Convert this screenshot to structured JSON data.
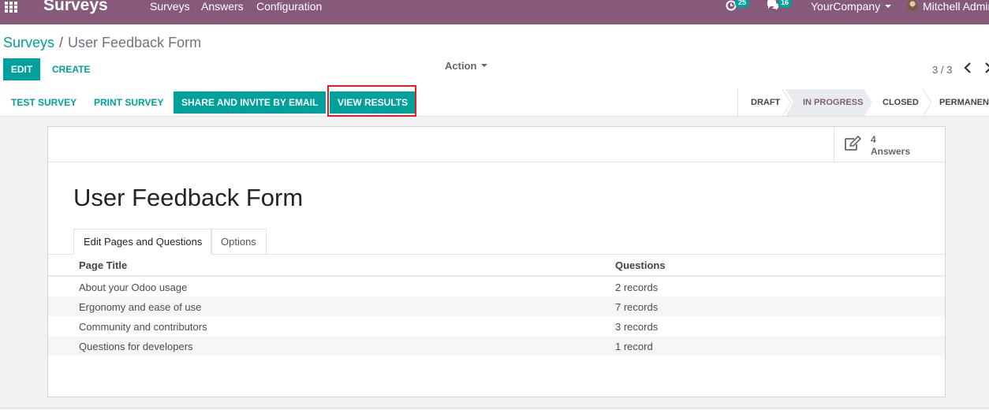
{
  "navbar": {
    "app_name": "Surveys",
    "menu": [
      "Surveys",
      "Answers",
      "Configuration"
    ],
    "activity_count": "25",
    "message_count": "16",
    "company": "YourCompany",
    "user": "Mitchell Admin"
  },
  "breadcrumb": {
    "parent": "Surveys",
    "current": "User Feedback Form"
  },
  "buttons": {
    "edit": "EDIT",
    "create": "CREATE",
    "action": "Action"
  },
  "pager": {
    "value": "3 / 3"
  },
  "statusbar": {
    "buttons": [
      "TEST SURVEY",
      "PRINT SURVEY",
      "SHARE AND INVITE BY EMAIL",
      "VIEW RESULTS"
    ],
    "stages": [
      "DRAFT",
      "IN PROGRESS",
      "CLOSED",
      "PERMANENT"
    ],
    "current_stage": "IN PROGRESS"
  },
  "stat_button": {
    "value": "4",
    "label": "Answers"
  },
  "form": {
    "title": "User Feedback Form",
    "tabs": [
      "Edit Pages and Questions",
      "Options"
    ]
  },
  "list": {
    "columns": [
      "Page Title",
      "Questions"
    ],
    "rows": [
      {
        "title": "About your Odoo usage",
        "questions": "2 records"
      },
      {
        "title": "Ergonomy and ease of use",
        "questions": "7 records"
      },
      {
        "title": "Community and contributors",
        "questions": "3 records"
      },
      {
        "title": "Questions for developers",
        "questions": "1 record"
      }
    ]
  },
  "colors": {
    "navbar": "#875a7b",
    "accent": "#00a09d",
    "highlight": "#e31c22"
  }
}
